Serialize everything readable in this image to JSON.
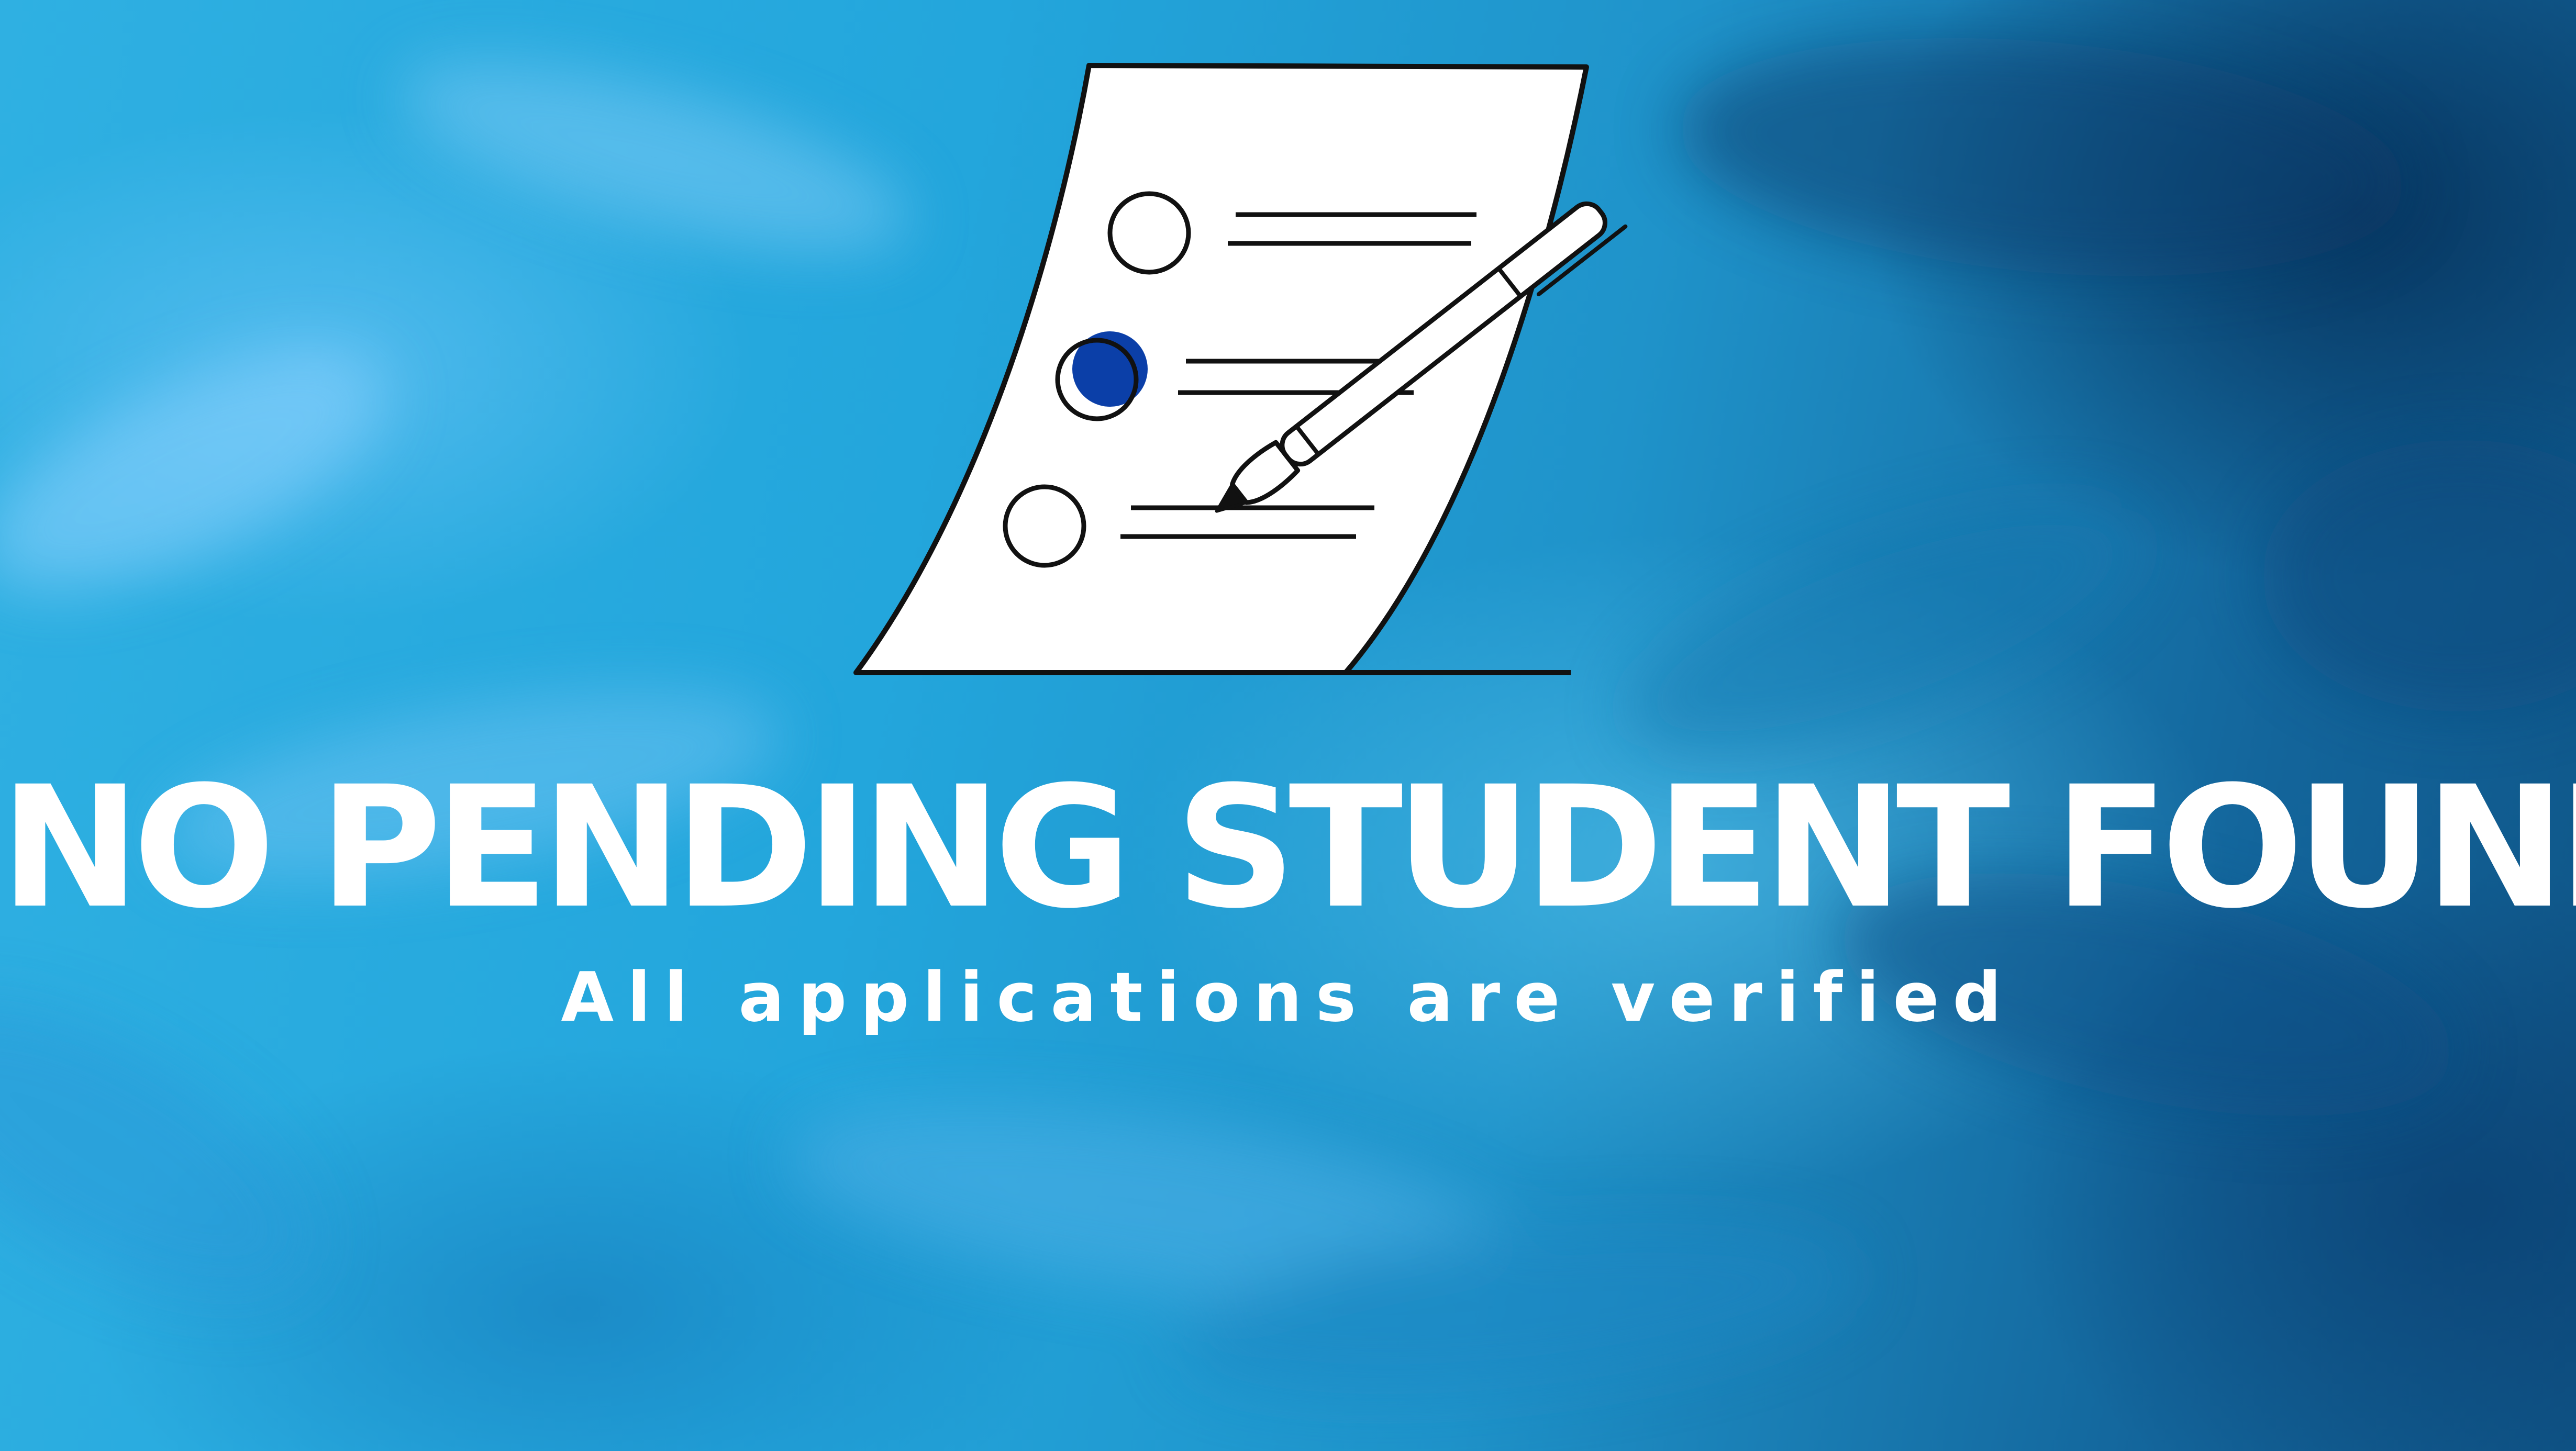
{
  "message": {
    "title": "NO PENDING STUDENT FOUND",
    "subtitle": "All applications are verified"
  },
  "illustration": {
    "icon": "document-checklist-pen-icon",
    "options": [
      {
        "name": "option-1",
        "selected": false
      },
      {
        "name": "option-2",
        "selected": true
      },
      {
        "name": "option-3",
        "selected": false
      }
    ]
  },
  "colors": {
    "background_light": "#2fb0e2",
    "background_dark": "#0f5587",
    "text": "#ffffff",
    "paper": "#ffffff",
    "outline": "#111111",
    "selected_mark": "#0b3fa8"
  }
}
